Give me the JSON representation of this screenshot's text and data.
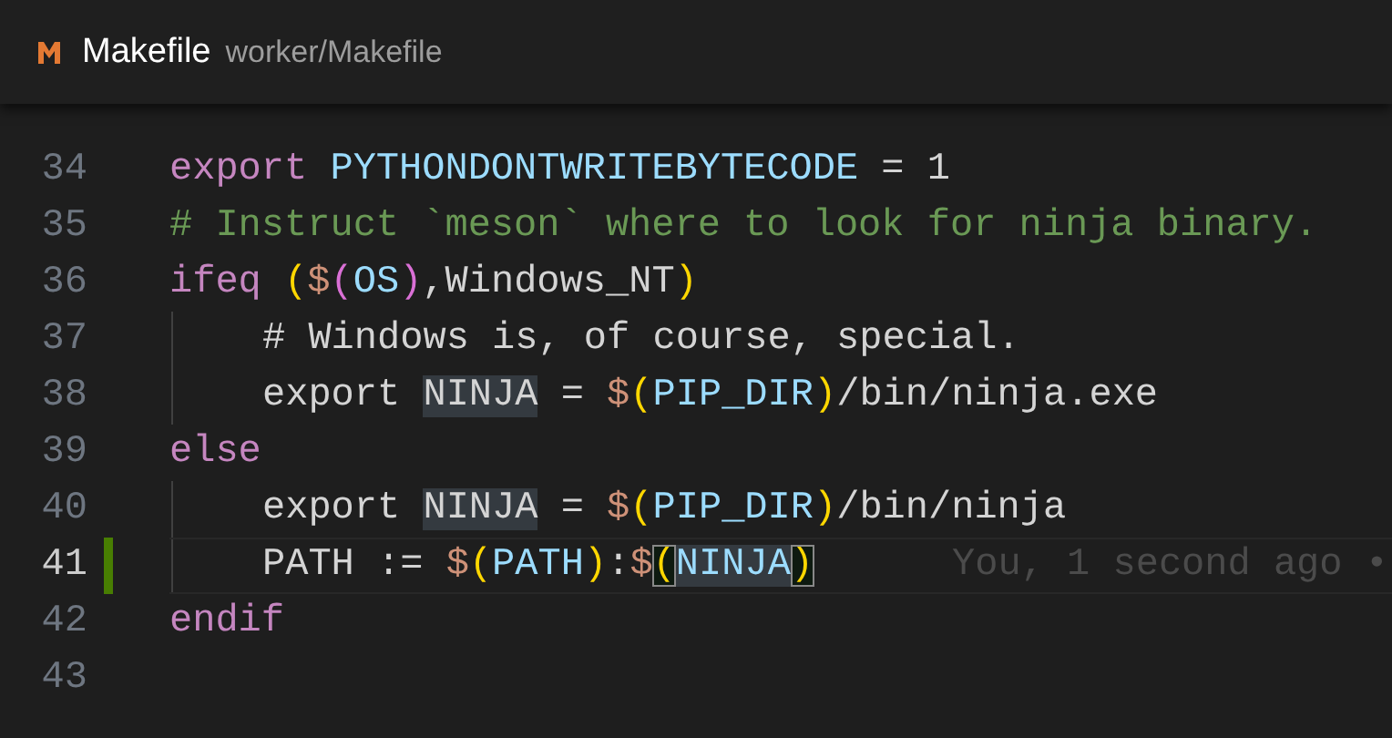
{
  "tab": {
    "title": "Makefile",
    "path": "worker/Makefile"
  },
  "lines": [
    {
      "number": "34",
      "current": false,
      "modified": false,
      "indented": false,
      "tokens": [
        {
          "kind": "keyword",
          "text": "export "
        },
        {
          "kind": "variable",
          "text": "PYTHONDONTWRITEBYTECODE"
        },
        {
          "kind": "text",
          "text": " = 1"
        }
      ]
    },
    {
      "number": "35",
      "current": false,
      "modified": false,
      "indented": false,
      "tokens": [
        {
          "kind": "comment",
          "text": "# Instruct `meson` where to look for ninja binary."
        }
      ]
    },
    {
      "number": "36",
      "current": false,
      "modified": false,
      "indented": false,
      "tokens": [
        {
          "kind": "keyword",
          "text": "ifeq "
        },
        {
          "kind": "bracket",
          "text": "("
        },
        {
          "kind": "sigil-nested",
          "text": "$"
        },
        {
          "kind": "bracket-nested",
          "text": "("
        },
        {
          "kind": "variable",
          "text": "OS"
        },
        {
          "kind": "bracket-nested",
          "text": ")"
        },
        {
          "kind": "text",
          "text": ",Windows_NT"
        },
        {
          "kind": "bracket",
          "text": ")"
        }
      ]
    },
    {
      "number": "37",
      "current": false,
      "modified": false,
      "indented": true,
      "tokens": [
        {
          "kind": "text",
          "text": "# Windows is, of course, special."
        }
      ]
    },
    {
      "number": "38",
      "current": false,
      "modified": false,
      "indented": true,
      "tokens": [
        {
          "kind": "text",
          "text": "export "
        },
        {
          "kind": "text",
          "text": "NINJA",
          "highlighted": true
        },
        {
          "kind": "text",
          "text": " = "
        },
        {
          "kind": "sigil",
          "text": "$"
        },
        {
          "kind": "bracket",
          "text": "("
        },
        {
          "kind": "variable",
          "text": "PIP_DIR"
        },
        {
          "kind": "bracket",
          "text": ")"
        },
        {
          "kind": "text",
          "text": "/bin/ninja.exe"
        }
      ]
    },
    {
      "number": "39",
      "current": false,
      "modified": false,
      "indented": false,
      "tokens": [
        {
          "kind": "keyword",
          "text": "else"
        }
      ]
    },
    {
      "number": "40",
      "current": false,
      "modified": false,
      "indented": true,
      "tokens": [
        {
          "kind": "text",
          "text": "export "
        },
        {
          "kind": "text",
          "text": "NINJA",
          "highlighted": true
        },
        {
          "kind": "text",
          "text": " = "
        },
        {
          "kind": "sigil",
          "text": "$"
        },
        {
          "kind": "bracket",
          "text": "("
        },
        {
          "kind": "variable",
          "text": "PIP_DIR"
        },
        {
          "kind": "bracket",
          "text": ")"
        },
        {
          "kind": "text",
          "text": "/bin/ninja"
        }
      ]
    },
    {
      "number": "41",
      "current": true,
      "modified": true,
      "indented": true,
      "blame": "You, 1 second ago •",
      "tokens": [
        {
          "kind": "text",
          "text": "PATH := "
        },
        {
          "kind": "sigil",
          "text": "$"
        },
        {
          "kind": "bracket",
          "text": "("
        },
        {
          "kind": "variable",
          "text": "PATH"
        },
        {
          "kind": "bracket",
          "text": ")"
        },
        {
          "kind": "text",
          "text": ":"
        },
        {
          "kind": "sigil",
          "text": "$"
        },
        {
          "kind": "bracket",
          "text": "(",
          "matched": true
        },
        {
          "kind": "variable",
          "text": "NINJA",
          "highlighted": true
        },
        {
          "kind": "bracket",
          "text": ")",
          "matched": true
        }
      ]
    },
    {
      "number": "42",
      "current": false,
      "modified": false,
      "indented": false,
      "tokens": [
        {
          "kind": "keyword",
          "text": "endif"
        }
      ]
    },
    {
      "number": "43",
      "current": false,
      "modified": false,
      "indented": false
    }
  ]
}
